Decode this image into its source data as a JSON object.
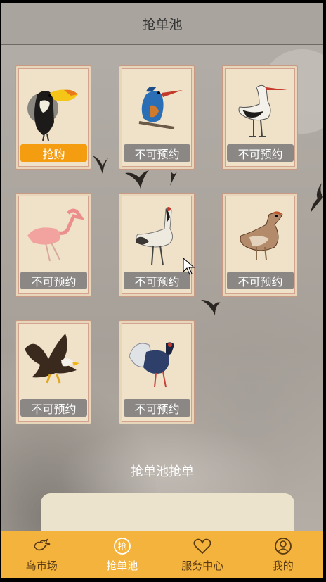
{
  "header": {
    "title": "抢单池"
  },
  "cards": [
    {
      "bird_icon": "toucan-icon",
      "button": "抢购"
    },
    {
      "bird_icon": "kingfisher-icon",
      "button": "不可预约"
    },
    {
      "bird_icon": "stork-icon",
      "button": "不可预约"
    },
    {
      "bird_icon": "flamingo-icon",
      "button": "不可预约"
    },
    {
      "bird_icon": "crane-icon",
      "button": "不可预约"
    },
    {
      "bird_icon": "partridge-icon",
      "button": "不可预约"
    },
    {
      "bird_icon": "eagle-icon",
      "button": "不可预约"
    },
    {
      "bird_icon": "pheasant-icon",
      "button": "不可预约"
    }
  ],
  "section": {
    "title": "抢单池抢单"
  },
  "tabs": [
    {
      "label": "鸟市场",
      "icon": "bird-market-icon"
    },
    {
      "label": "抢单池",
      "icon": "grab-pool-icon"
    },
    {
      "label": "服务中心",
      "icon": "heart-icon"
    },
    {
      "label": "我的",
      "icon": "user-icon"
    }
  ],
  "colors": {
    "active_button": "#f59d11",
    "disabled_button": "#8a8785",
    "tabbar": "#f3b33d"
  }
}
